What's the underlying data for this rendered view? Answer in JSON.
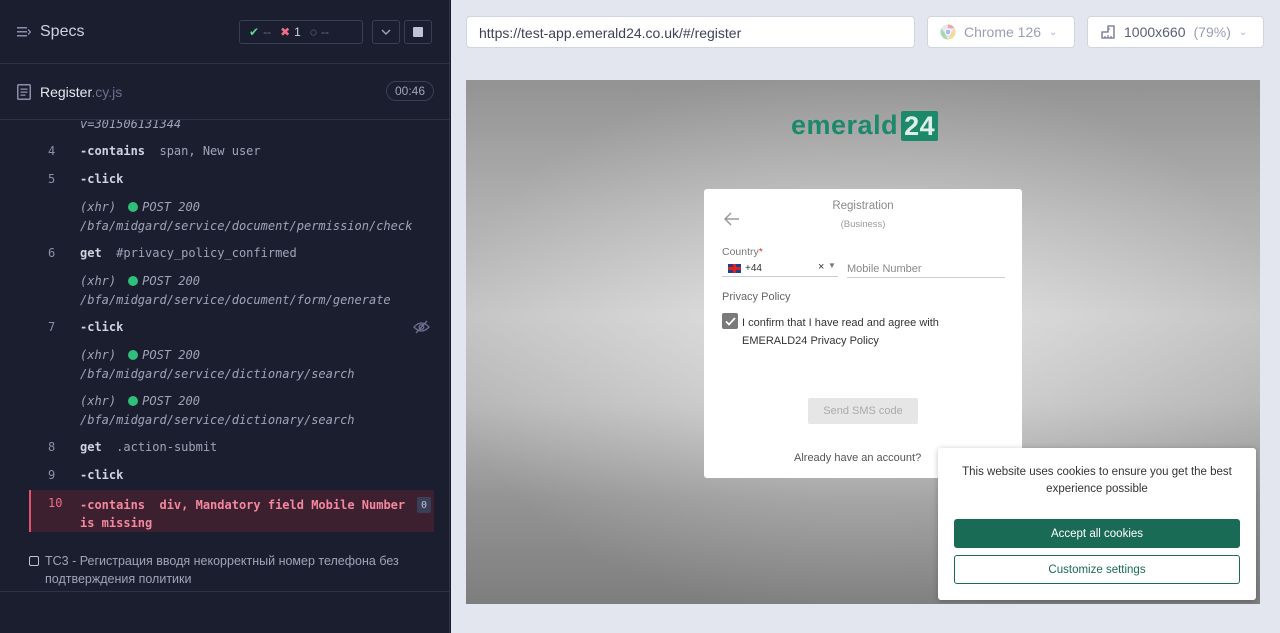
{
  "specs_header": {
    "title": "Specs",
    "passed": "--",
    "failed": "1",
    "pending": "--"
  },
  "spec_file": {
    "name": "Register",
    "ext": ".cy.js",
    "duration": "00:46"
  },
  "command_log": {
    "overflow_line": "v=301506131344",
    "c4_num": "4",
    "c4_name": "-contains",
    "c4_arg": "span, New user",
    "c5_num": "5",
    "c5_name": "-click",
    "x1_label": "(xhr)",
    "x1_method": "POST 200",
    "x1_path": "/bfa/midgard/service/document/permission/check",
    "c6_num": "6",
    "c6_name": "get",
    "c6_arg": "#privacy_policy_confirmed",
    "x2_label": "(xhr)",
    "x2_method": "POST 200",
    "x2_path": "/bfa/midgard/service/document/form/generate",
    "c7_num": "7",
    "c7_name": "-click",
    "x3_label": "(xhr)",
    "x3_method": "POST 200",
    "x3_path": "/bfa/midgard/service/dictionary/search",
    "x4_label": "(xhr)",
    "x4_method": "POST 200",
    "x4_path": "/bfa/midgard/service/dictionary/search",
    "c8_num": "8",
    "c8_name": "get",
    "c8_arg": ".action-submit",
    "c9_num": "9",
    "c9_name": "-click",
    "c10_num": "10",
    "c10_name": "-contains",
    "c10_arg": "div, Mandatory field Mobile Number is missing",
    "c10_badge": "0"
  },
  "next_test": {
    "label": "TC3 - Регистрация вводя некорректный номер телефона без подтверждения политики"
  },
  "browser_toolbar": {
    "url": "https://test-app.emerald24.co.uk/#/register",
    "browser": "Chrome 126",
    "viewport": "1000x660",
    "zoom": "(79%)"
  },
  "app": {
    "logo_text": "emerald",
    "logo_box": "24",
    "reg_title": "Registration",
    "reg_subtitle": "(Business)",
    "country_label": "Country",
    "country_required": "*",
    "country_value": "+44",
    "country_clear": "×",
    "mobile_placeholder": "Mobile Number",
    "privacy_label": "Privacy Policy",
    "privacy_text": "I confirm that I have read and agree with EMERALD24 Privacy Policy",
    "send_sms": "Send SMS code",
    "already": "Already have an account?"
  },
  "cookie_banner": {
    "text": "This website uses cookies to ensure you get the best experience possible",
    "accept": "Accept all cookies",
    "customize": "Customize settings"
  },
  "colors": {
    "brand_green": "#1c8a6a",
    "accept_green": "#1a6b56",
    "fail_red": "#f26d86",
    "pass_green": "#5fd39c",
    "panel_dark": "#1b1e2e"
  }
}
